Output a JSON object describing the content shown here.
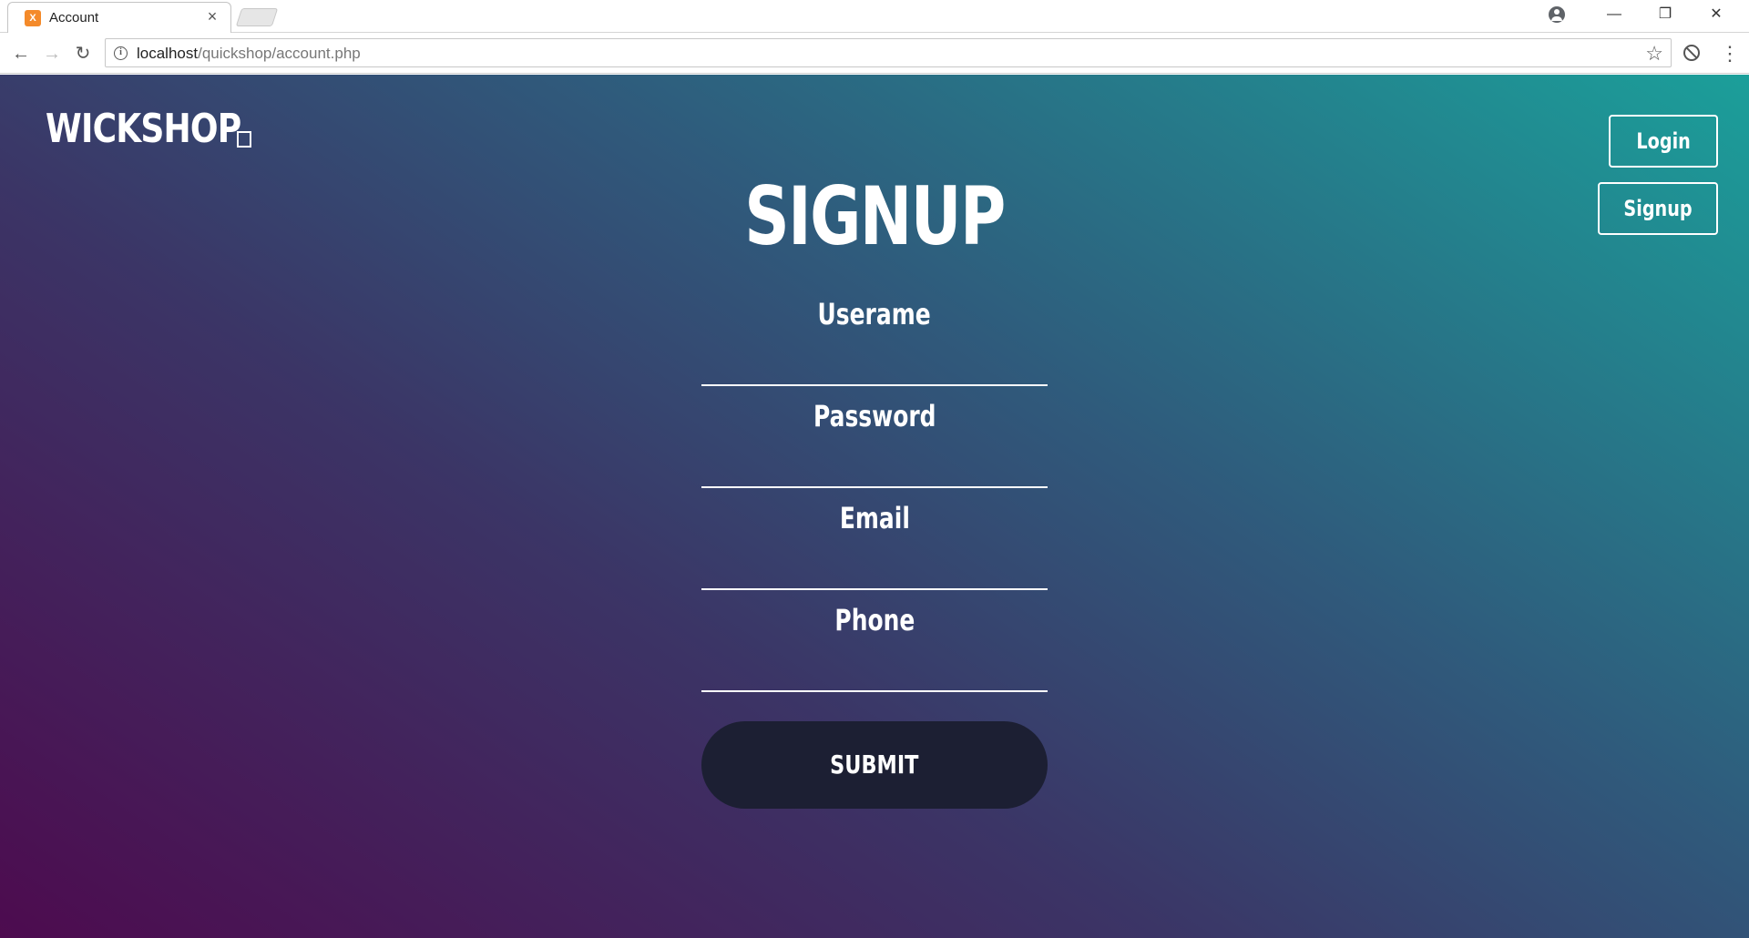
{
  "browser": {
    "tab_title": "Account",
    "tab_close": "×",
    "favicon_letter": "X",
    "url_host": "localhost",
    "url_path": "/quickshop/account.php",
    "window": {
      "minimize": "—",
      "restore": "❐",
      "close": "✕"
    },
    "icons": [
      "xampp-favicon",
      "profile-icon",
      "back-icon",
      "forward-icon",
      "reload-icon",
      "info-icon",
      "star-icon",
      "block-icon",
      "menu-icon"
    ]
  },
  "page": {
    "brand": "WICKSHOP",
    "nav": {
      "login": "Login",
      "signup": "Signup"
    },
    "form": {
      "title": "SIGNUP",
      "fields": [
        {
          "label": "Userame",
          "value": ""
        },
        {
          "label": "Password",
          "value": ""
        },
        {
          "label": "Email",
          "value": ""
        },
        {
          "label": "Phone",
          "value": ""
        }
      ],
      "submit": "SUBMIT"
    }
  },
  "colors": {
    "gradient_start": "#4d0b4f",
    "gradient_mid": "#2f5b7c",
    "gradient_end": "#1b9f9a",
    "submit_bg": "#1c1f33"
  }
}
